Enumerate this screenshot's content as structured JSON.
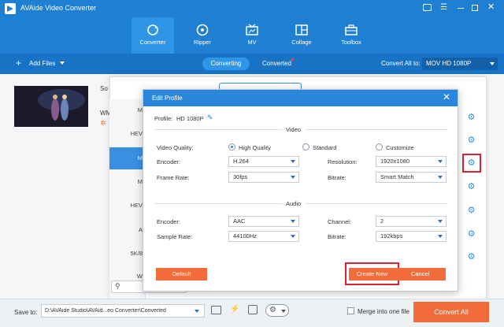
{
  "app": {
    "title": "AVAide Video Converter"
  },
  "nav": [
    {
      "label": "Converter",
      "icon": "converter-icon",
      "active": true
    },
    {
      "label": "Ripper",
      "icon": "ripper-icon",
      "active": false
    },
    {
      "label": "MV",
      "icon": "mv-icon",
      "active": false
    },
    {
      "label": "Collage",
      "icon": "collage-icon",
      "active": false
    },
    {
      "label": "Toolbox",
      "icon": "toolbox-icon",
      "active": false
    }
  ],
  "toolbar": {
    "add_files": "Add Files",
    "tab_converting": "Converting",
    "tab_converted": "Converted",
    "convert_all_to_label": "Convert All to:",
    "convert_all_to_value": "MOV HD 1080P"
  },
  "file": {
    "source_prefix": "So",
    "format_prefix": "WM"
  },
  "format_list": [
    "M",
    "HEV",
    "M",
    "M",
    "HEV",
    "A",
    "5K/8",
    "W"
  ],
  "dialog": {
    "title": "Edit Profile",
    "profile_label": "Profile:",
    "profile_value": "HD 1080P",
    "video_section": "Video",
    "audio_section": "Audio",
    "video_quality_label": "Video Quality:",
    "quality_options": [
      "High Quality",
      "Standard",
      "Customize"
    ],
    "quality_selected": "High Quality",
    "encoder_label": "Encoder:",
    "encoder_value": "H.264",
    "resolution_label": "Resolution:",
    "resolution_value": "1920x1080",
    "frame_rate_label": "Frame Rate:",
    "frame_rate_value": "30fps",
    "bitrate_label": "Bitrate:",
    "bitrate_value": "Smart Match",
    "audio_encoder_label": "Encoder:",
    "audio_encoder_value": "AAC",
    "channel_label": "Channel:",
    "channel_value": "2",
    "sample_rate_label": "Sample Rate:",
    "sample_rate_value": "44100Hz",
    "audio_bitrate_label": "Bitrate:",
    "audio_bitrate_value": "192kbps",
    "default_button": "Default",
    "create_new_button": "Create New",
    "cancel_button": "Cancel"
  },
  "bottom": {
    "save_to_label": "Save to:",
    "save_to_value": "D:\\AVAide Studio\\AVAid...eo Converter\\Converted",
    "merge_label": "Merge into one file",
    "convert_all_button": "Convert All"
  },
  "colors": {
    "primary": "#1f7fd2",
    "accent": "#f26b3a",
    "highlight": "#d9232e"
  }
}
